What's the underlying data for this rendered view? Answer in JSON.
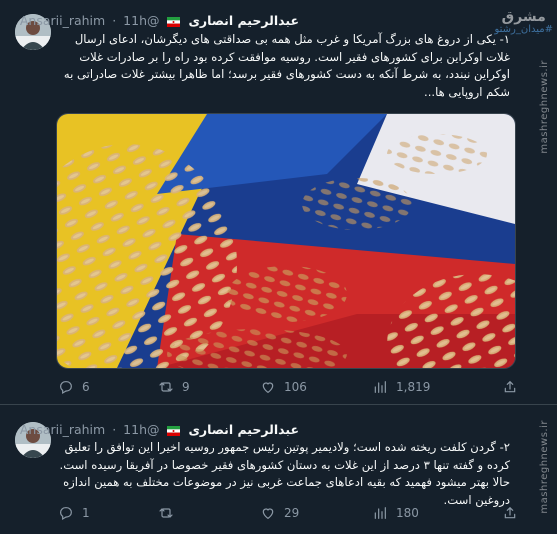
{
  "tweets": [
    {
      "name": "عبدالرحیم انصاری",
      "handle": "@Ansarii_rahim",
      "time": "11h",
      "text": "۱- یکی از دروغ های بزرگ آمریکا و غرب مثل همه بی صداقتی های دیگرشان، ادعای ارسال غلات اوکراین برای کشورهای فقیر است. روسیه موافقت کرده بود راه را بر صادرات غلات اوکراین نبندد، به شرط آنکه به دست کشورهای فقیر برسد؛ اما ظاهرا بیشتر غلات صادراتی به شکم اروپایی ها...",
      "image_alt": "wheat grains on Ukrainian and Russian flags",
      "actions": {
        "replies": "6",
        "retweets": "9",
        "likes": "106",
        "views": "1,819"
      }
    },
    {
      "name": "عبدالرحیم انصاری",
      "handle": "@Ansarii_rahim",
      "time": "11h",
      "text": "۲- گردن کلفت ریخته شده است؛ ولادیمیر پوتین رئیس جمهور روسیه اخیرا این توافق را تعلیق کرده و گفته تنها ۳ درصد از این غلات به دستان کشورهای فقیر خصوصا در آفریقا رسیده است. حالا بهتر میشود فهمید که بقیه ادعاهای جماعت غربی نیز در موضوعات مختلف به همین اندازه دروغین است.",
      "actions": {
        "replies": "1",
        "retweets": "",
        "likes": "29",
        "views": "180"
      }
    }
  ],
  "watermark": {
    "logo": "مشرق",
    "tag": "#میدان_رشتو",
    "site": "mashreghnews.ir"
  },
  "colors": {
    "background": "#15202b",
    "muted": "#8b98a5",
    "divider": "#38444d"
  }
}
